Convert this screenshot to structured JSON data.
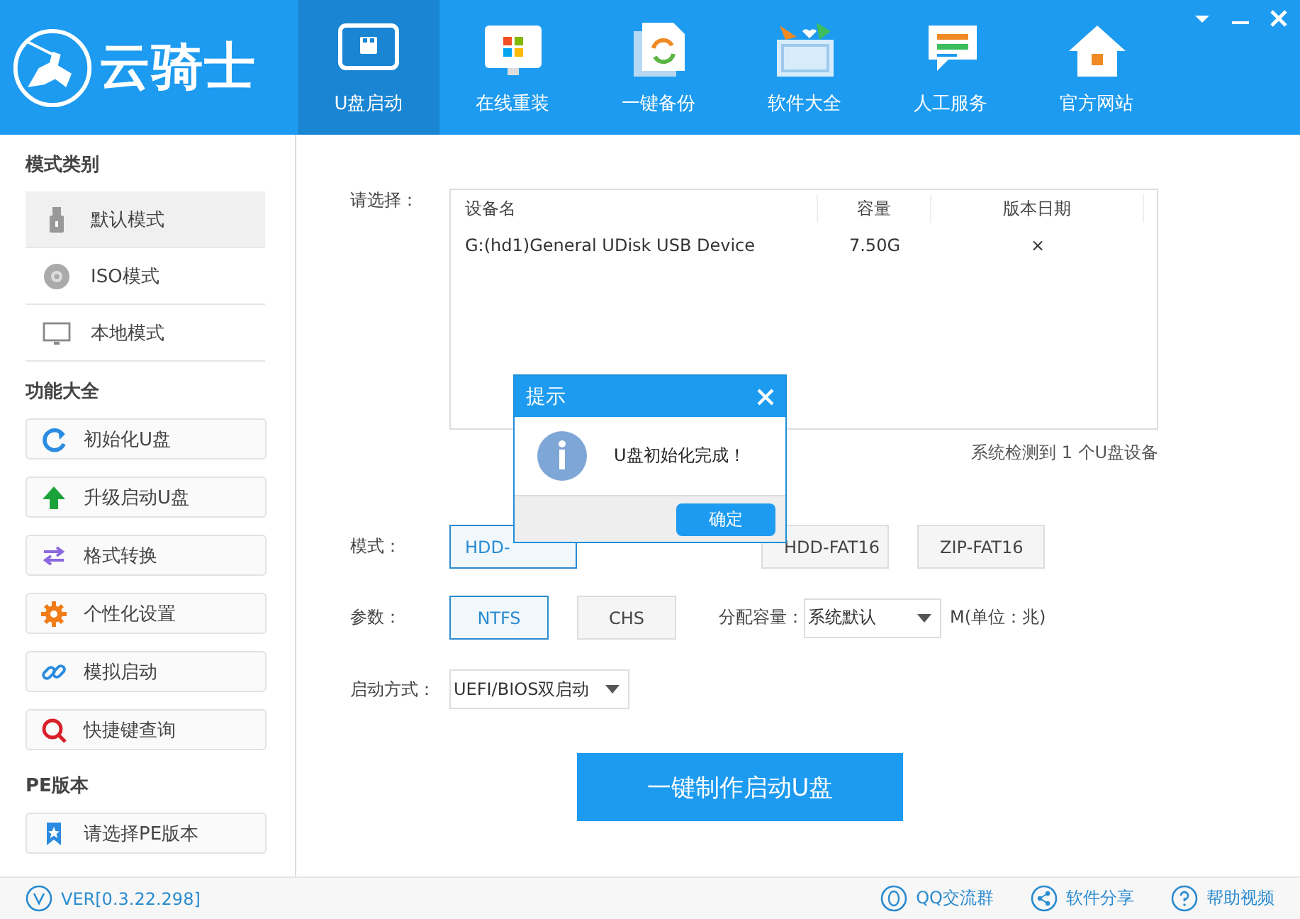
{
  "logo": "云骑士",
  "nav_tabs": [
    {
      "label": "U盘启动",
      "selected": true
    },
    {
      "label": "在线重装",
      "selected": false
    },
    {
      "label": "一键备份",
      "selected": false
    },
    {
      "label": "软件大全",
      "selected": false
    },
    {
      "label": "人工服务",
      "selected": false
    },
    {
      "label": "官方网站",
      "selected": false
    }
  ],
  "sidebar": [
    {
      "title": "模式类别",
      "kind": "list",
      "items": [
        {
          "label": "默认模式",
          "selected": true
        },
        {
          "label": "ISO模式",
          "selected": false
        },
        {
          "label": "本地模式",
          "selected": false
        }
      ]
    },
    {
      "title": "功能大全",
      "kind": "buttons",
      "items": [
        {
          "label": "初始化U盘"
        },
        {
          "label": "升级启动U盘"
        },
        {
          "label": "格式转换"
        },
        {
          "label": "个性化设置"
        },
        {
          "label": "模拟启动"
        },
        {
          "label": "快捷键查询"
        }
      ]
    },
    {
      "title": "PE版本",
      "kind": "buttons",
      "items": [
        {
          "label": "请选择PE版本"
        }
      ]
    }
  ],
  "device_picker": {
    "label": "请选择：",
    "columns": [
      "设备名",
      "容量",
      "版本日期"
    ],
    "rows": [
      [
        "G:(hd1)General UDisk USB Device",
        "7.50G",
        "×"
      ]
    ],
    "status": "系统检测到 1 个U盘设备"
  },
  "mode": {
    "label": "模式：",
    "options": [
      {
        "label": "HDD-",
        "selected": true
      },
      {
        "label": "HDD-FAT16",
        "selected": false
      },
      {
        "label": "ZIP-FAT16",
        "selected": false
      }
    ]
  },
  "params": {
    "label": "参数：",
    "options": [
      {
        "label": "NTFS",
        "selected": true
      },
      {
        "label": "CHS",
        "selected": false
      }
    ],
    "alloc_label": "分配容量：",
    "alloc_value": "系统默认",
    "unit": "M(单位：兆)"
  },
  "boot": {
    "label": "启动方式：",
    "value": "UEFI/BIOS双启动"
  },
  "make_button": "一键制作启动U盘",
  "dialog": {
    "title": "提示",
    "message": "U盘初始化完成！",
    "ok": "确定"
  },
  "footer": {
    "version": "VER[0.3.22.298]",
    "links": [
      "QQ交流群",
      "软件分享",
      "帮助视频"
    ]
  }
}
